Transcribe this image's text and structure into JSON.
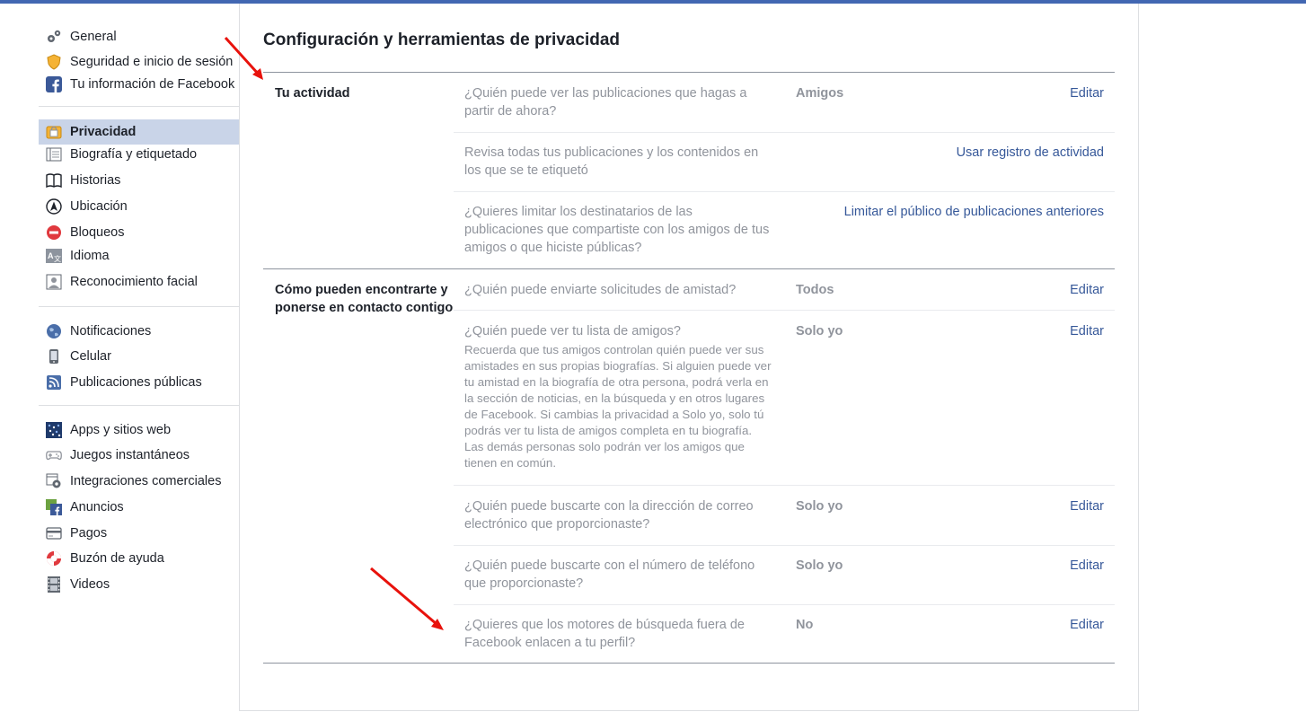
{
  "colors": {
    "accent": "#4267b2",
    "link": "#365899",
    "muted": "#90949c",
    "active_bg": "#c9d4e8",
    "annotation_arrow": "#e8120c"
  },
  "sidebar": {
    "groups": [
      {
        "items": [
          {
            "label": "General",
            "icon": "gear-icon"
          },
          {
            "label": "Seguridad e inicio de sesión",
            "icon": "shield-icon"
          },
          {
            "label": "Tu información de Facebook",
            "icon": "facebook-icon"
          }
        ]
      },
      {
        "items": [
          {
            "label": "Privacidad",
            "icon": "lock-icon",
            "active": true
          },
          {
            "label": "Biografía y etiquetado",
            "icon": "timeline-icon"
          },
          {
            "label": "Historias",
            "icon": "book-icon"
          },
          {
            "label": "Ubicación",
            "icon": "location-icon"
          },
          {
            "label": "Bloqueos",
            "icon": "block-icon"
          },
          {
            "label": "Idioma",
            "icon": "language-icon"
          },
          {
            "label": "Reconocimiento facial",
            "icon": "face-icon"
          }
        ]
      },
      {
        "items": [
          {
            "label": "Notificaciones",
            "icon": "globe-icon"
          },
          {
            "label": "Celular",
            "icon": "phone-icon"
          },
          {
            "label": "Publicaciones públicas",
            "icon": "rss-icon"
          }
        ]
      },
      {
        "items": [
          {
            "label": "Apps y sitios web",
            "icon": "apps-icon"
          },
          {
            "label": "Juegos instantáneos",
            "icon": "gamepad-icon"
          },
          {
            "label": "Integraciones comerciales",
            "icon": "business-gear-icon"
          },
          {
            "label": "Anuncios",
            "icon": "ads-icon"
          },
          {
            "label": "Pagos",
            "icon": "card-icon"
          },
          {
            "label": "Buzón de ayuda",
            "icon": "lifebuoy-icon"
          },
          {
            "label": "Videos",
            "icon": "film-icon"
          }
        ]
      }
    ]
  },
  "main": {
    "title": "Configuración y herramientas de privacidad",
    "sections": [
      {
        "title": "Tu actividad",
        "rows": [
          {
            "question": "¿Quién puede ver las publicaciones que hagas a partir de ahora?",
            "value": "Amigos",
            "action": "Editar"
          },
          {
            "question": "Revisa todas tus publicaciones y los contenidos en los que se te etiquetó",
            "value": "",
            "action": "Usar registro de actividad"
          },
          {
            "question": "¿Quieres limitar los destinatarios de las publicaciones que compartiste con los amigos de tus amigos o que hiciste públicas?",
            "value": "",
            "action": "Limitar el público de publicaciones anteriores"
          }
        ]
      },
      {
        "title": "Cómo pueden encontrarte y ponerse en contacto contigo",
        "rows": [
          {
            "question": "¿Quién puede enviarte solicitudes de amistad?",
            "value": "Todos",
            "action": "Editar"
          },
          {
            "question": "¿Quién puede ver tu lista de amigos?",
            "description": "Recuerda que tus amigos controlan quién puede ver sus amistades en sus propias biografías. Si alguien puede ver tu amistad en la biografía de otra persona, podrá verla en la sección de noticias, en la búsqueda y en otros lugares de Facebook. Si cambias la privacidad a Solo yo, solo tú podrás ver tu lista de amigos completa en tu biografía. Las demás personas solo podrán ver los amigos que tienen en común.",
            "value": "Solo yo",
            "action": "Editar"
          },
          {
            "question": "¿Quién puede buscarte con la dirección de correo electrónico que proporcionaste?",
            "value": "Solo yo",
            "action": "Editar"
          },
          {
            "question": "¿Quién puede buscarte con el número de teléfono que proporcionaste?",
            "value": "Solo yo",
            "action": "Editar"
          },
          {
            "question": "¿Quieres que los motores de búsqueda fuera de Facebook enlacen a tu perfil?",
            "value": "No",
            "action": "Editar"
          }
        ]
      }
    ]
  }
}
